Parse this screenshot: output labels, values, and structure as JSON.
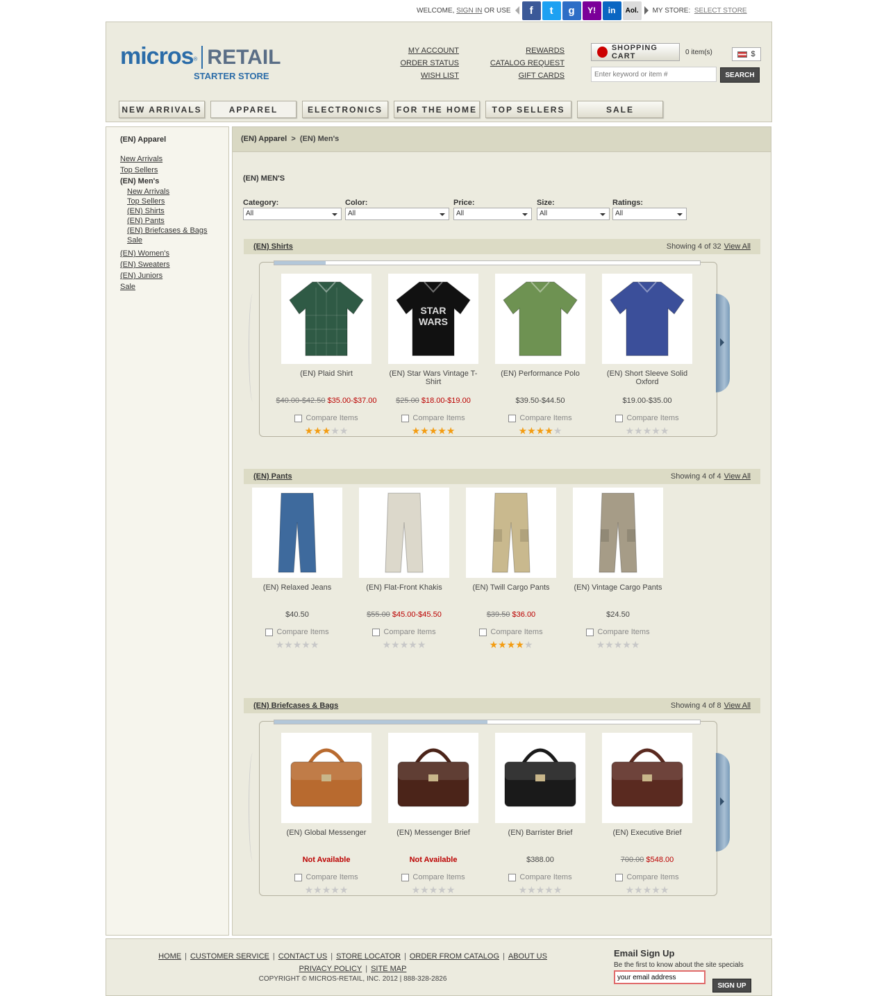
{
  "topbar": {
    "welcome": "WELCOME,",
    "sign_in": "SIGN IN",
    "or_use": "OR USE",
    "social": [
      "facebook-icon",
      "twitter-icon",
      "google-icon",
      "yahoo-icon",
      "linkedin-icon",
      "aol-icon"
    ],
    "social_labels": [
      "f",
      "t",
      "g",
      "Y!",
      "in",
      "Aol."
    ],
    "social_colors": [
      "#3b5998",
      "#1da1f2",
      "#2d6ec6",
      "#7b0099",
      "#0a66c2",
      "#dcdcdc"
    ],
    "my_store": "MY STORE:",
    "select_store": "SELECT STORE"
  },
  "header": {
    "logo_micros": "micros",
    "logo_retail": "RETAIL",
    "logo_starter": "STARTER STORE",
    "links_left": [
      "MY ACCOUNT",
      "ORDER STATUS",
      "WISH LIST"
    ],
    "links_right": [
      "REWARDS",
      "CATALOG REQUEST",
      "GIFT CARDS"
    ],
    "cart_label": "SHOPPING CART",
    "cart_count": "0 item(s)",
    "currency": "$",
    "search_placeholder": "Enter keyword or item #",
    "search_button": "SEARCH"
  },
  "nav": [
    "NEW ARRIVALS",
    "APPAREL",
    "ELECTRONICS",
    "FOR THE HOME",
    "TOP SELLERS",
    "SALE"
  ],
  "nav_active": 1,
  "sidebar": {
    "title": "(EN) Apparel",
    "items": [
      {
        "label": "New Arrivals",
        "level": 0
      },
      {
        "label": "Top Sellers",
        "level": 0
      },
      {
        "label": "(EN) Men's",
        "level": 0,
        "current": true
      },
      {
        "label": "New Arrivals",
        "level": 1
      },
      {
        "label": "Top Sellers",
        "level": 1
      },
      {
        "label": "(EN) Shirts",
        "level": 1
      },
      {
        "label": "(EN) Pants",
        "level": 1
      },
      {
        "label": "(EN) Briefcases & Bags",
        "level": 1
      },
      {
        "label": "Sale",
        "level": 1
      },
      {
        "label": "(EN) Women's",
        "level": 0
      },
      {
        "label": "(EN) Sweaters",
        "level": 0
      },
      {
        "label": "(EN) Juniors",
        "level": 0
      },
      {
        "label": "Sale",
        "level": 0
      }
    ]
  },
  "breadcrumb": {
    "root": "(EN) Apparel",
    "sep": ">",
    "current": "(EN) Men's"
  },
  "page_title": "(EN) MEN'S",
  "filters": [
    {
      "label": "Category:",
      "value": "All"
    },
    {
      "label": "Color:",
      "value": "All"
    },
    {
      "label": "Price:",
      "value": "All"
    },
    {
      "label": "Size:",
      "value": "All"
    },
    {
      "label": "Ratings:",
      "value": "All"
    }
  ],
  "compare_label": "Compare Items",
  "view_all": "View All",
  "sections": [
    {
      "name": "(EN) Shirts",
      "showing": "Showing 4 of 32",
      "carousel": true,
      "scroll_fraction": 0.12,
      "products": [
        {
          "name": "(EN) Plaid Shirt",
          "was": "$40.00-$42.50",
          "now": "$35.00-$37.00",
          "price": "",
          "rating": 3,
          "img": "plaid-shirt",
          "color": "#2f5a45"
        },
        {
          "name": "(EN) Star Wars Vintage T-Shirt",
          "was": "$25.00",
          "now": "$18.00-$19.00",
          "price": "",
          "rating": 5,
          "img": "star-wars-tshirt",
          "color": "#111111"
        },
        {
          "name": "(EN) Performance Polo",
          "was": "",
          "now": "",
          "price": "$39.50-$44.50",
          "rating": 4,
          "img": "polo",
          "color": "#6e9252"
        },
        {
          "name": "(EN) Short Sleeve Solid Oxford",
          "was": "",
          "now": "",
          "price": "$19.00-$35.00",
          "rating": 0,
          "img": "oxford-shirt",
          "color": "#3b4f9a"
        }
      ]
    },
    {
      "name": "(EN) Pants",
      "showing": "Showing 4 of 4",
      "carousel": false,
      "products": [
        {
          "name": "(EN) Relaxed Jeans",
          "was": "",
          "now": "",
          "price": "$40.50",
          "rating": 0,
          "img": "jeans",
          "color": "#3e6a9d"
        },
        {
          "name": "(EN) Flat-Front Khakis",
          "was": "$55.00",
          "now": "$45.00-$45.50",
          "price": "",
          "rating": 0,
          "img": "khakis",
          "color": "#dcd8cb"
        },
        {
          "name": "(EN) Twill Cargo Pants",
          "was": "$39.50",
          "now": "$36.00",
          "price": "",
          "rating": 4,
          "img": "cargo-pants",
          "color": "#c9b98e"
        },
        {
          "name": "(EN) Vintage Cargo Pants",
          "was": "",
          "now": "",
          "price": "$24.50",
          "rating": 0,
          "img": "vintage-cargo",
          "color": "#a69c87"
        }
      ]
    },
    {
      "name": "(EN) Briefcases & Bags",
      "showing": "Showing 4 of 8",
      "carousel": true,
      "scroll_fraction": 0.5,
      "products": [
        {
          "name": "(EN) Global Messenger",
          "was": "",
          "now": "",
          "price": "",
          "na": "Not Available",
          "rating": 0,
          "img": "messenger",
          "color": "#b86a2f"
        },
        {
          "name": "(EN) Messenger Brief",
          "was": "",
          "now": "",
          "price": "",
          "na": "Not Available",
          "rating": 0,
          "img": "messenger-brief",
          "color": "#4b2419"
        },
        {
          "name": "(EN) Barrister Brief",
          "was": "",
          "now": "",
          "price": "$388.00",
          "rating": 0,
          "img": "barrister",
          "color": "#1a1a1a"
        },
        {
          "name": "(EN) Executive Brief",
          "was": "700.00",
          "now": "$548.00",
          "price": "",
          "rating": 0,
          "img": "executive",
          "color": "#5a2a20"
        }
      ]
    }
  ],
  "footer": {
    "links_row1": [
      "HOME",
      "CUSTOMER SERVICE",
      "CONTACT US",
      "STORE LOCATOR",
      "ORDER FROM CATALOG",
      "ABOUT US"
    ],
    "links_row2": [
      "PRIVACY POLICY",
      "SITE MAP"
    ],
    "copyright": "COPYRIGHT © MICROS-RETAIL, INC. 2012 | 888-328-2826",
    "signup_title": "Email Sign Up",
    "signup_desc": "Be the first to know about the site specials",
    "email_placeholder": "your email address",
    "signup_button": "SIGN UP"
  }
}
